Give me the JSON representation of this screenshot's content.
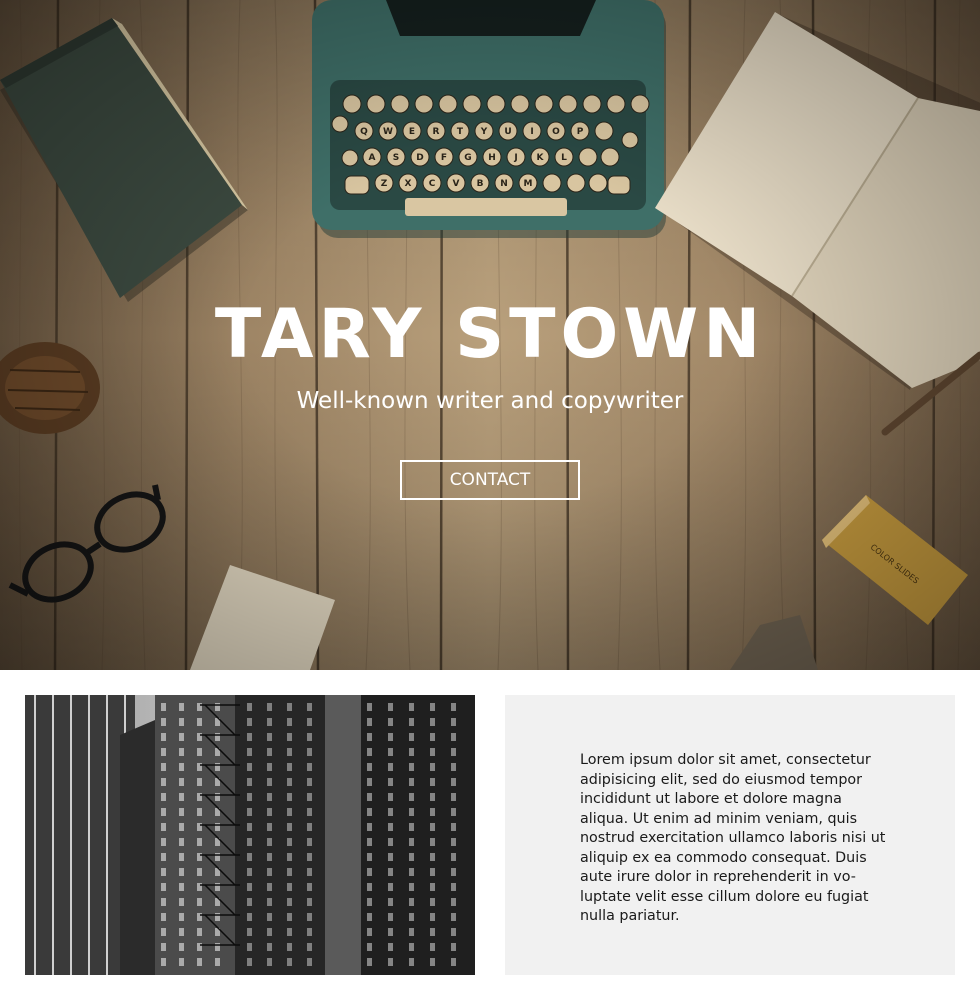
{
  "hero": {
    "title": "TARY STOWN",
    "subtitle": "Well-known writer and copywriter",
    "contact_label": "CONTACT",
    "keyboard_keys": [
      "Q",
      "W",
      "E",
      "R",
      "T",
      "Y",
      "U",
      "I",
      "O",
      "P",
      "A",
      "S",
      "D",
      "F",
      "G",
      "H",
      "J",
      "K",
      "L",
      "Z",
      "X",
      "C",
      "V",
      "B",
      "N",
      "M"
    ],
    "slide_box_label": "COLOR SLIDES"
  },
  "content": {
    "body_text": "Lorem ipsum dolor sit amet, consectetur adipisicing elit, sed do eiusmod tempor incididunt ut labore et dolore magna aliqua. Ut enim ad minim veniam, quis nostrud exercitation ullamco laboris nisi ut aliquip ex ea commodo consequat. Duis aute irure dolor in reprehenderit in vo-luptate velit esse cillum dolore eu fugiat nulla pariatur."
  },
  "colors": {
    "hero_text": "#ffffff",
    "panel_bg": "#f1f1f1",
    "body_text": "#1a1a1a",
    "wood": "#b49a76",
    "typewriter": "#3f6f68"
  }
}
